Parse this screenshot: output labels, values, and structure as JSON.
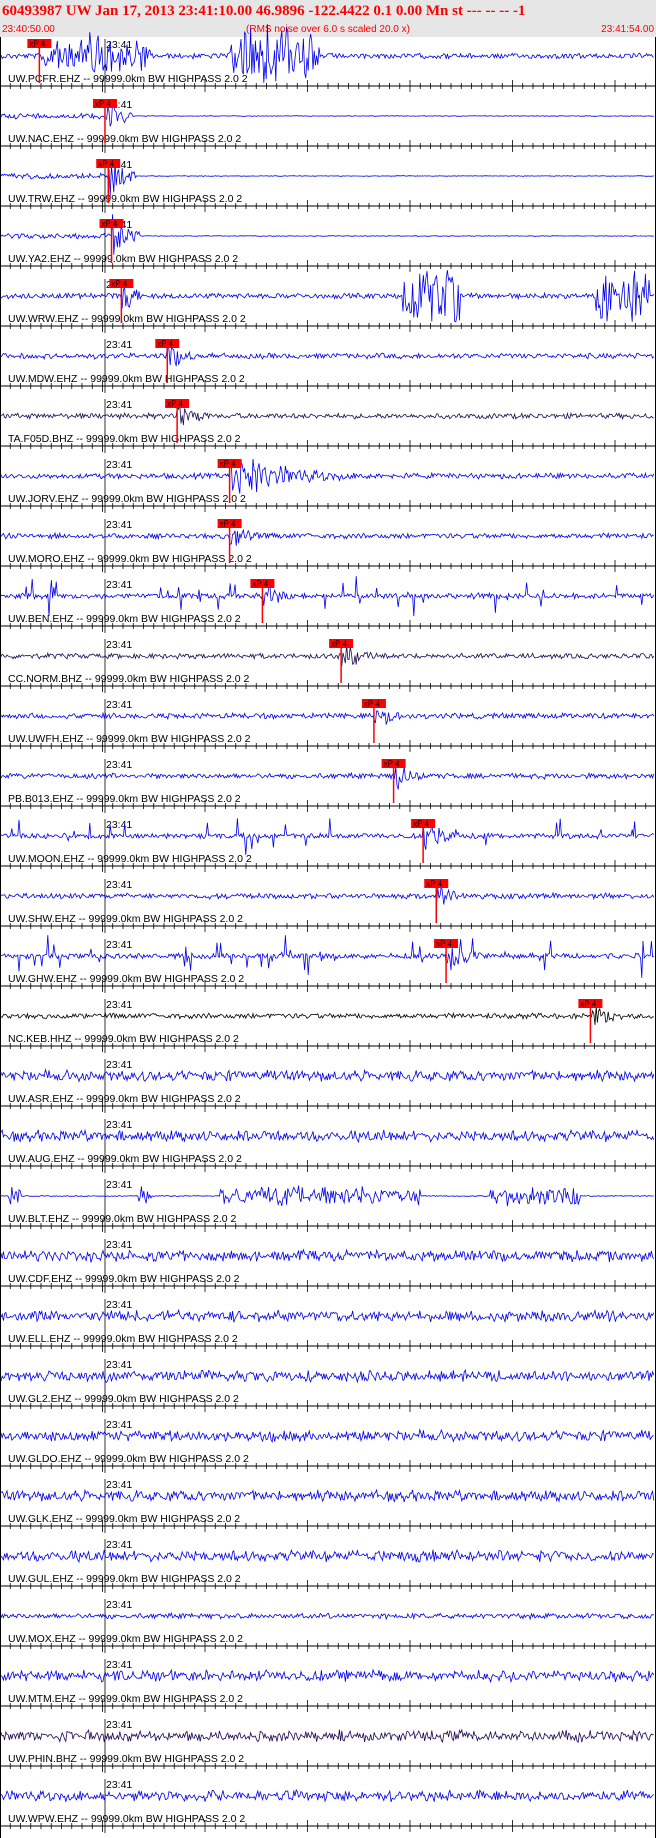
{
  "header": {
    "title": "60493987 UW Jan 17, 2013 23:41:10.00   46.9896 -122.4422  0.1 0.00 Mn st --- -- --  -1",
    "time_start": "23:40:50.00",
    "rms_note": "(RMS noise over 6.0 s scaled 20.0 x)",
    "time_end": "23:41:54.00"
  },
  "colors": {
    "header_bg": "#e6e6e6",
    "header_text": "#ff0000",
    "trace_blue": "#0000ee",
    "trace_navy": "#1a0a55",
    "trace_black": "#000000",
    "pick_red": "#ff0000"
  },
  "minute_label": "23:41",
  "pick_label": "xP 4",
  "traces": [
    {
      "label": "UW.PCFR.EHZ -- 99999.0km BW  HIGHPASS  2.0  2",
      "pick": 0.06,
      "color": "blue",
      "style": "big"
    },
    {
      "label": "UW.NAC.EHZ -- 99999.0km BW  HIGHPASS  2.0  2",
      "pick": 0.16,
      "color": "blue",
      "style": "cut"
    },
    {
      "label": "UW.TRW.EHZ -- 99999.0km BW  HIGHPASS  2.0  2",
      "pick": 0.165,
      "color": "blue",
      "style": "cut"
    },
    {
      "label": "UW.YA2.EHZ -- 99999.0km BW  HIGHPASS  2.0  2",
      "pick": 0.17,
      "color": "blue",
      "style": "cut"
    },
    {
      "label": "UW.WRW.EHZ -- 99999.0km BW  HIGHPASS  2.0  2",
      "pick": 0.185,
      "color": "blue",
      "style": "blocks"
    },
    {
      "label": "UW.MDW.EHZ -- 99999.0km BW  HIGHPASS  2.0  2",
      "pick": 0.255,
      "color": "blue",
      "style": "event"
    },
    {
      "label": "TA.F05D.BHZ -- 99999.0km BW  HIGHPASS  2.0  2",
      "pick": 0.27,
      "color": "navy",
      "style": "event"
    },
    {
      "label": "UW.JORV.EHZ -- 99999.0km BW  HIGHPASS  2.0  2",
      "pick": 0.35,
      "color": "blue",
      "style": "bigevent"
    },
    {
      "label": "UW.MORO.EHZ -- 99999.0km BW  HIGHPASS  2.0  2",
      "pick": 0.35,
      "color": "blue",
      "style": "event"
    },
    {
      "label": "UW.BEN.EHZ -- 99999.0km BW  HIGHPASS  2.0  2",
      "pick": 0.4,
      "color": "blue",
      "style": "spiky"
    },
    {
      "label": "CC.NORM.BHZ -- 99999.0km BW  HIGHPASS  2.0  2",
      "pick": 0.52,
      "color": "navy",
      "style": "event"
    },
    {
      "label": "UW.UWFH.EHZ -- 99999.0km BW  HIGHPASS  2.0  2",
      "pick": 0.57,
      "color": "blue",
      "style": "event"
    },
    {
      "label": "PB.B013.EHZ -- 99999.0km BW  HIGHPASS  2.0  2",
      "pick": 0.6,
      "color": "blue",
      "style": "event"
    },
    {
      "label": "UW.MOON.EHZ -- 99999.0km BW  HIGHPASS  2.0  2",
      "pick": 0.645,
      "color": "blue",
      "style": "spiky"
    },
    {
      "label": "UW.SHW.EHZ -- 99999.0km BW  HIGHPASS  2.0  2",
      "pick": 0.665,
      "color": "blue",
      "style": "event"
    },
    {
      "label": "UW.GHW.EHZ -- 99999.0km BW  HIGHPASS  2.0  2",
      "pick": 0.68,
      "color": "blue",
      "style": "spiky"
    },
    {
      "label": "NC.KEB.HHZ -- 99999.0km BW  HIGHPASS  2.0  2",
      "pick": 0.9,
      "color": "black",
      "style": "event"
    },
    {
      "label": "UW.ASR.EHZ -- 99999.0km BW  HIGHPASS  2.0  2",
      "pick": null,
      "color": "blue",
      "style": "noise"
    },
    {
      "label": "UW.AUG.EHZ -- 99999.0km BW  HIGHPASS  2.0  2",
      "pick": null,
      "color": "blue",
      "style": "noise"
    },
    {
      "label": "UW.BLT.EHZ -- 99999.0km BW  HIGHPASS  2.0  2",
      "pick": null,
      "color": "blue",
      "style": "bursts"
    },
    {
      "label": "UW.CDF.EHZ -- 99999.0km BW  HIGHPASS  2.0  2",
      "pick": null,
      "color": "blue",
      "style": "noise"
    },
    {
      "label": "UW.ELL.EHZ -- 99999.0km BW  HIGHPASS  2.0  2",
      "pick": null,
      "color": "blue",
      "style": "noise"
    },
    {
      "label": "UW.GL2.EHZ -- 99999.0km BW  HIGHPASS  2.0  2",
      "pick": null,
      "color": "blue",
      "style": "noise"
    },
    {
      "label": "UW.GLDO.EHZ -- 99999.0km BW  HIGHPASS  2.0  2",
      "pick": null,
      "color": "blue",
      "style": "noise"
    },
    {
      "label": "UW.GLK.EHZ -- 99999.0km BW  HIGHPASS  2.0  2",
      "pick": null,
      "color": "blue",
      "style": "noise"
    },
    {
      "label": "UW.GUL.EHZ -- 99999.0km BW  HIGHPASS  2.0  2",
      "pick": null,
      "color": "blue",
      "style": "noise"
    },
    {
      "label": "UW.MOX.EHZ -- 99999.0km BW  HIGHPASS  2.0  2",
      "pick": null,
      "color": "blue",
      "style": "cut"
    },
    {
      "label": "UW.MTM.EHZ -- 99999.0km BW  HIGHPASS  2.0  2",
      "pick": null,
      "color": "blue",
      "style": "noise"
    },
    {
      "label": "UW.PHIN.BHZ -- 99999.0km BW  HIGHPASS  2.0  2",
      "pick": null,
      "color": "navy",
      "style": "noise"
    },
    {
      "label": "UW.WPW.EHZ -- 99999.0km BW  HIGHPASS  2.0  2",
      "pick": null,
      "color": "blue",
      "style": "noise"
    }
  ]
}
